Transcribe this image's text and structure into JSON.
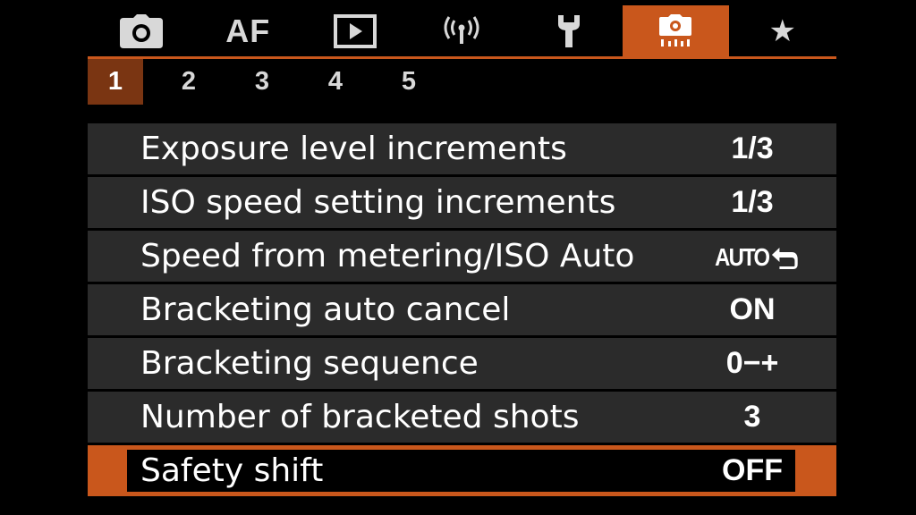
{
  "tabs": [
    {
      "name": "tab-shooting",
      "icon": "camera-icon",
      "active": false
    },
    {
      "name": "tab-af",
      "label": "AF",
      "active": false
    },
    {
      "name": "tab-playback",
      "icon": "play-icon",
      "active": false
    },
    {
      "name": "tab-wireless",
      "icon": "wireless-icon",
      "active": false
    },
    {
      "name": "tab-setup",
      "icon": "wrench-icon",
      "active": false
    },
    {
      "name": "tab-custom-functions",
      "icon": "custom-camera-icon",
      "active": true
    },
    {
      "name": "tab-my-menu",
      "icon": "star-icon",
      "active": false
    }
  ],
  "colors": {
    "accent": "#c9571c",
    "subtab_active": "#7a3512",
    "row_bg": "#2b2b2b"
  },
  "subtabs": [
    "1",
    "2",
    "3",
    "4",
    "5"
  ],
  "active_subtab": "1",
  "menu": {
    "items": [
      {
        "label": "Exposure level increments",
        "value": "1/3"
      },
      {
        "label": "ISO speed setting increments",
        "value": "1/3"
      },
      {
        "label": "Speed from metering/ISO Auto",
        "value": "AUTO",
        "value_icon": "return-arrow-icon"
      },
      {
        "label": "Bracketing auto cancel",
        "value": "ON"
      },
      {
        "label": "Bracketing sequence",
        "value": "0−+"
      },
      {
        "label": "Number of bracketed shots",
        "value": "3"
      },
      {
        "label": "Safety shift",
        "value": "OFF",
        "selected": true
      }
    ]
  }
}
